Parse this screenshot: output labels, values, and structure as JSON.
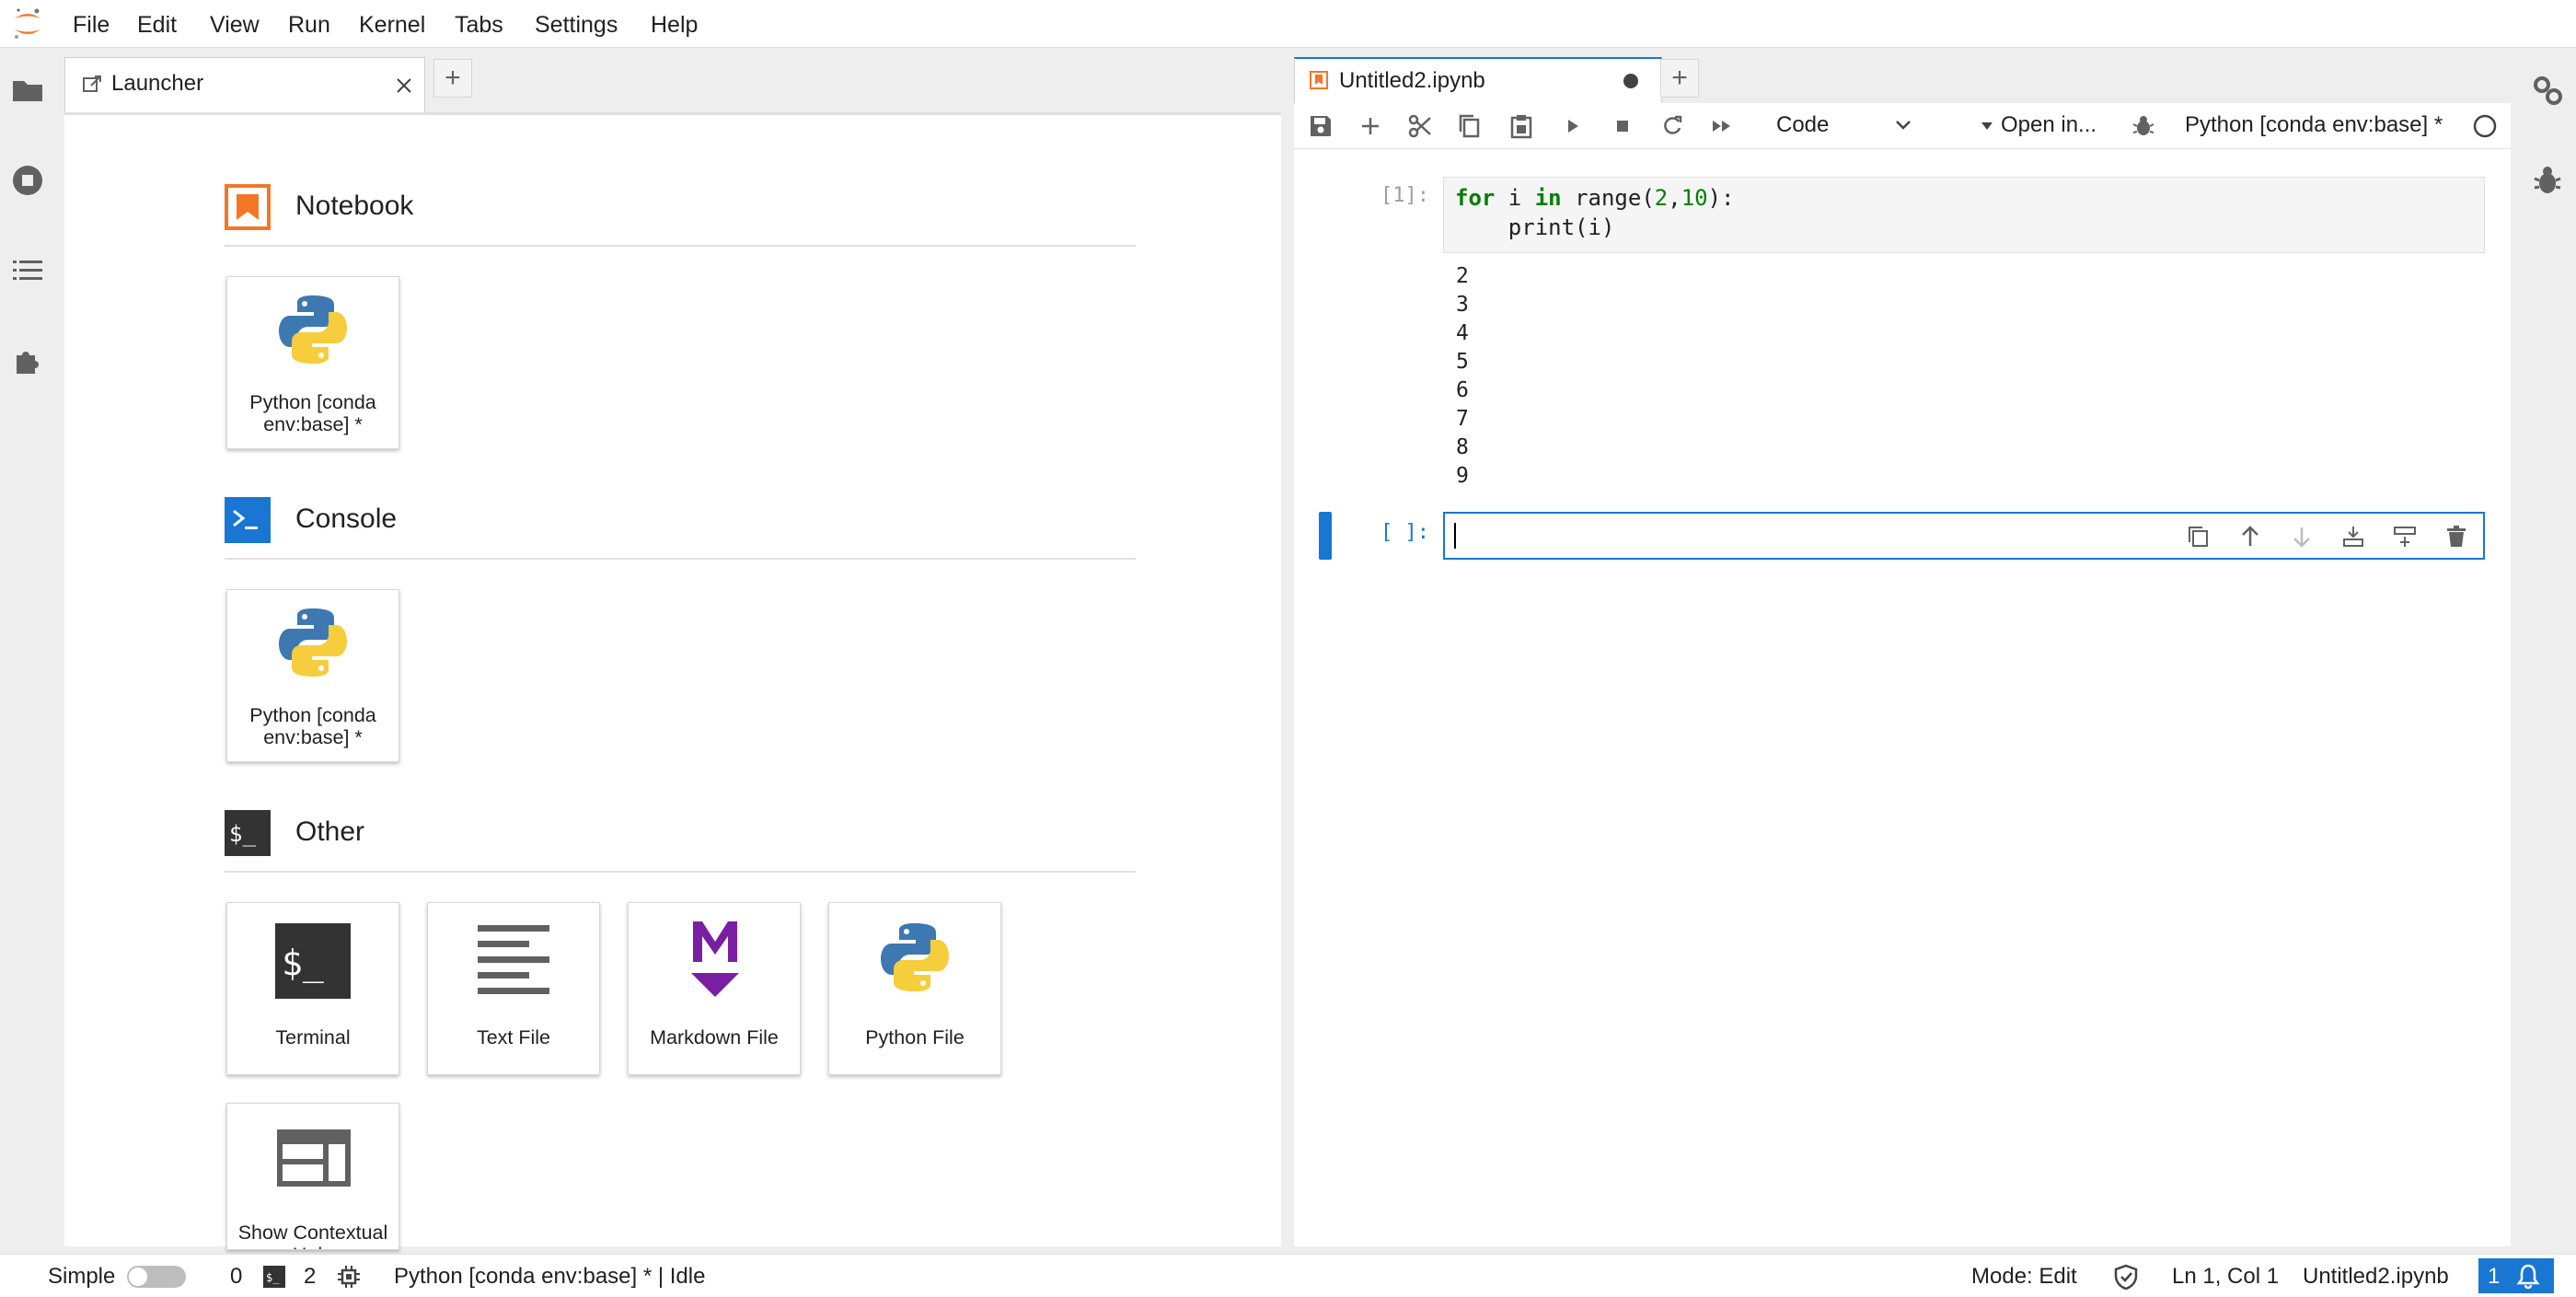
{
  "menu": [
    "File",
    "Edit",
    "View",
    "Run",
    "Kernel",
    "Tabs",
    "Settings",
    "Help"
  ],
  "launcher_tab": {
    "label": "Launcher"
  },
  "notebook_tab": {
    "label": "Untitled2.ipynb"
  },
  "launcher": {
    "notebook": {
      "title": "Notebook",
      "cards": [
        {
          "label_line1": "Python [conda",
          "label_line2": "env:base] *"
        }
      ]
    },
    "console": {
      "title": "Console",
      "cards": [
        {
          "label_line1": "Python [conda",
          "label_line2": "env:base] *"
        }
      ]
    },
    "other": {
      "title": "Other",
      "cards": [
        {
          "label": "Terminal"
        },
        {
          "label": "Text File"
        },
        {
          "label": "Markdown File"
        },
        {
          "label": "Python File"
        },
        {
          "label": "Show Contextual Help"
        }
      ]
    }
  },
  "toolbar": {
    "cell_type": "Code",
    "open_in": "Open in...",
    "kernel": "Python [conda env:base] *"
  },
  "cells": [
    {
      "prompt": "[1]:",
      "code_line1": {
        "kw1": "for",
        "t1": " i ",
        "kw2": "in",
        "t2": " range(",
        "n1": "2",
        "t3": ",",
        "n2": "10",
        "t4": "):"
      },
      "code_line2": "    print(i)",
      "outputs": [
        "2",
        "3",
        "4",
        "5",
        "6",
        "7",
        "8",
        "9"
      ]
    },
    {
      "prompt": "[ ]:"
    }
  ],
  "status": {
    "mode_label": "Simple",
    "terminals": "0",
    "kernels": "2",
    "kernel_status": "Python [conda env:base] * | Idle",
    "edit_mode": "Mode: Edit",
    "cursor": "Ln 1, Col 1",
    "file": "Untitled2.ipynb",
    "notifications": "1"
  },
  "colors": {
    "accent": "#1976d2",
    "notebook_orange": "#f37726",
    "markdown_purple": "#7b1fa2",
    "console_blue": "#1976d2",
    "terminal_dark": "#333333"
  }
}
